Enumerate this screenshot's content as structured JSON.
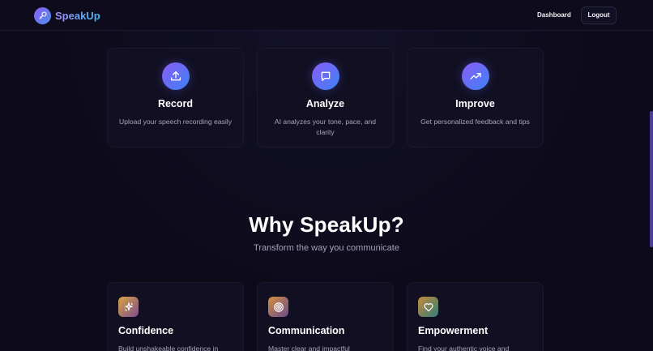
{
  "header": {
    "brand": "SpeakUp",
    "nav_dashboard": "Dashboard",
    "nav_logout": "Logout"
  },
  "steps": [
    {
      "title": "Record",
      "description": "Upload your speech recording easily",
      "icon": "upload-icon"
    },
    {
      "title": "Analyze",
      "description": "AI analyzes your tone, pace, and clarity",
      "icon": "chat-bubble-icon"
    },
    {
      "title": "Improve",
      "description": "Get personalized feedback and tips",
      "icon": "trending-up-icon"
    }
  ],
  "why": {
    "title": "Why SpeakUp?",
    "subtitle": "Transform the way you communicate"
  },
  "features": [
    {
      "title": "Confidence",
      "description": "Build unshakeable confidence in",
      "icon": "sparkles-icon"
    },
    {
      "title": "Communication",
      "description": "Master clear and impactful",
      "icon": "target-icon"
    },
    {
      "title": "Empowerment",
      "description": "Find your authentic voice and",
      "icon": "heart-icon"
    }
  ],
  "colors": {
    "background": "#0d0b1a",
    "card": "#110f21",
    "accent_purple": "#8b5cf6",
    "accent_blue": "#3b82f6"
  }
}
